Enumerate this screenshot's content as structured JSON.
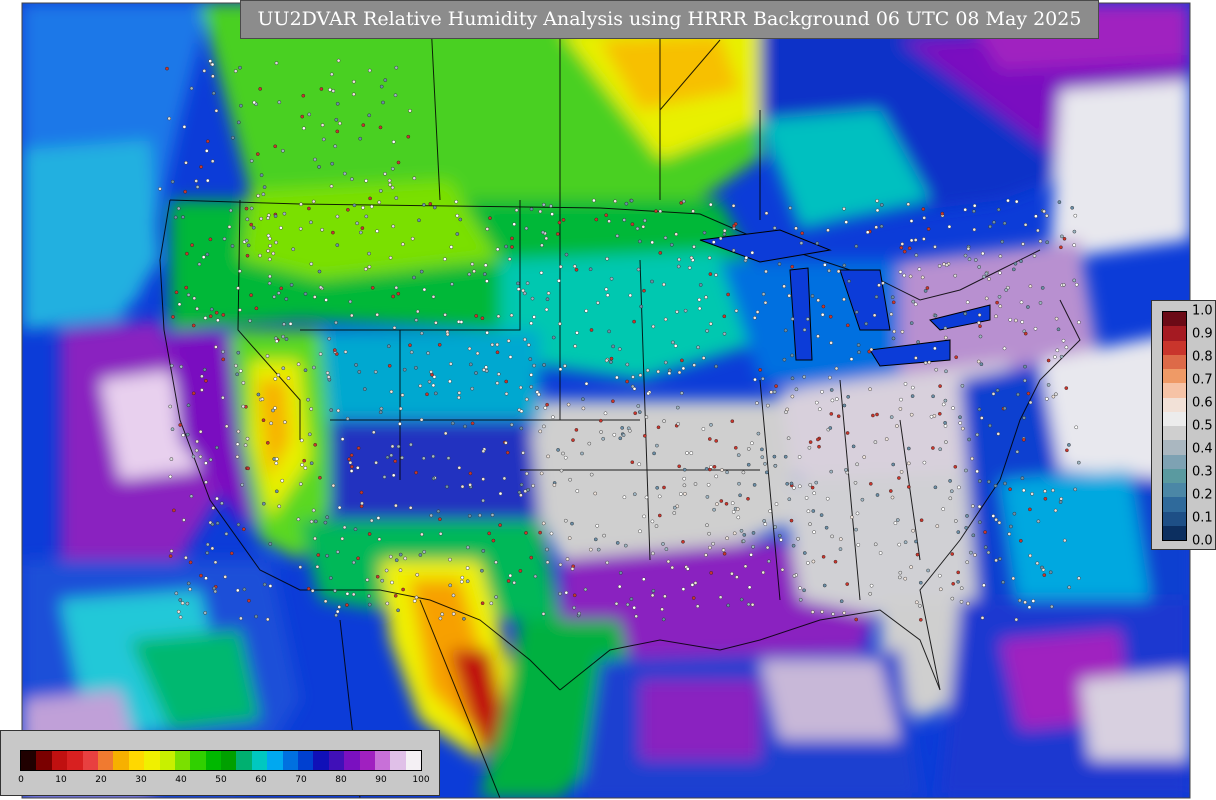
{
  "title": "UU2DVAR Relative Humidity Analysis using HRRR Background 06 UTC 08 May 2025",
  "humidity_scale": {
    "ticks": [
      "0",
      "10",
      "20",
      "30",
      "40",
      "50",
      "60",
      "70",
      "80",
      "90",
      "100"
    ],
    "colors": [
      "#200000",
      "#7a0000",
      "#c01010",
      "#d82020",
      "#e84040",
      "#f07a30",
      "#f7b000",
      "#ffd800",
      "#f0f000",
      "#c8f000",
      "#7ae000",
      "#30d000",
      "#00b800",
      "#00a000",
      "#00b070",
      "#00c8c0",
      "#00a8f0",
      "#0070e0",
      "#0040d0",
      "#1010b8",
      "#4010b8",
      "#7a10c0",
      "#a020c0",
      "#c870d8",
      "#e0c0e8",
      "#f4f0f4"
    ]
  },
  "observation_scale": {
    "labels": [
      "1.0",
      "0.9",
      "0.8",
      "0.7",
      "0.6",
      "0.5",
      "0.4",
      "0.3",
      "0.2",
      "0.1",
      "0.0"
    ],
    "colors": [
      "#6b0a16",
      "#a51a22",
      "#c9352c",
      "#dd6a48",
      "#ef9a66",
      "#f6c3a6",
      "#f2e1d7",
      "#ececec",
      "#cfcfcf",
      "#aab7c0",
      "#7ea2b3",
      "#5a9aa0",
      "#4b87a6",
      "#2f6a9b",
      "#1e4f86",
      "#0c2f60"
    ]
  }
}
